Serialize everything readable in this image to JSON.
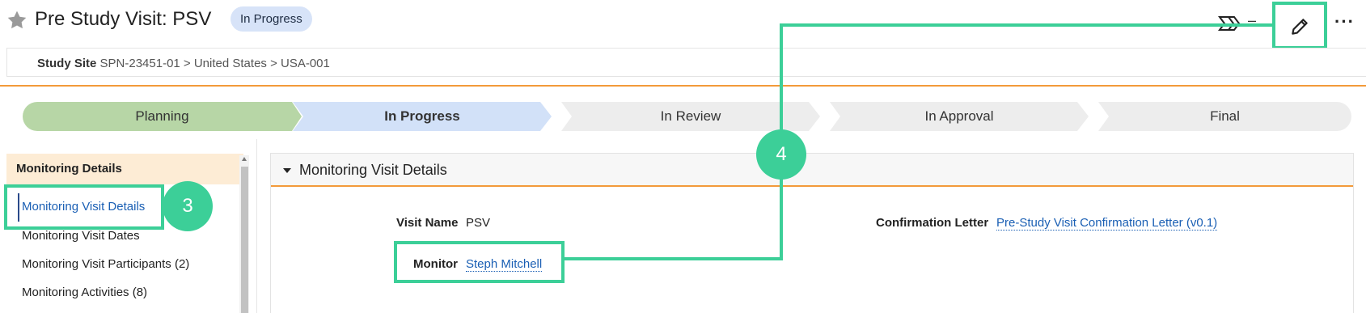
{
  "header": {
    "title": "Pre Study Visit: PSV",
    "status_badge": "In Progress",
    "dash": "–",
    "more": "···"
  },
  "breadcrumb": {
    "label": "Study Site",
    "path": "SPN-23451-01 > United States > USA-001"
  },
  "stages": [
    {
      "label": "Planning",
      "state": "complete"
    },
    {
      "label": "In Progress",
      "state": "current"
    },
    {
      "label": "In Review",
      "state": "pending"
    },
    {
      "label": "In Approval",
      "state": "pending"
    },
    {
      "label": "Final",
      "state": "pending"
    }
  ],
  "sidebar": {
    "heading": "Monitoring Details",
    "items": [
      {
        "label": "Monitoring Visit Details",
        "active": true
      },
      {
        "label": "Monitoring Visit Dates"
      },
      {
        "label": "Monitoring Visit Participants (2)"
      },
      {
        "label": "Monitoring Activities (8)"
      }
    ]
  },
  "section": {
    "title": "Monitoring Visit Details",
    "visit_name_label": "Visit Name",
    "visit_name_value": "PSV",
    "monitor_label": "Monitor",
    "monitor_value": "Steph Mitchell",
    "confirmation_label": "Confirmation Letter",
    "confirmation_value": "Pre-Study Visit Confirmation Letter (v0.1)"
  },
  "callouts": {
    "step_3": "3",
    "step_4": "4"
  },
  "colors": {
    "callout": "#3ccf98",
    "accent_orange": "#f39a3a",
    "stage_complete": "#b7d6a6",
    "stage_current": "#d2e1f8",
    "stage_pending": "#ededed",
    "link": "#1a5fb4"
  },
  "icons": [
    "star-icon",
    "workflow-arrows-icon",
    "pencil-icon",
    "more-icon",
    "caret-down-icon"
  ]
}
